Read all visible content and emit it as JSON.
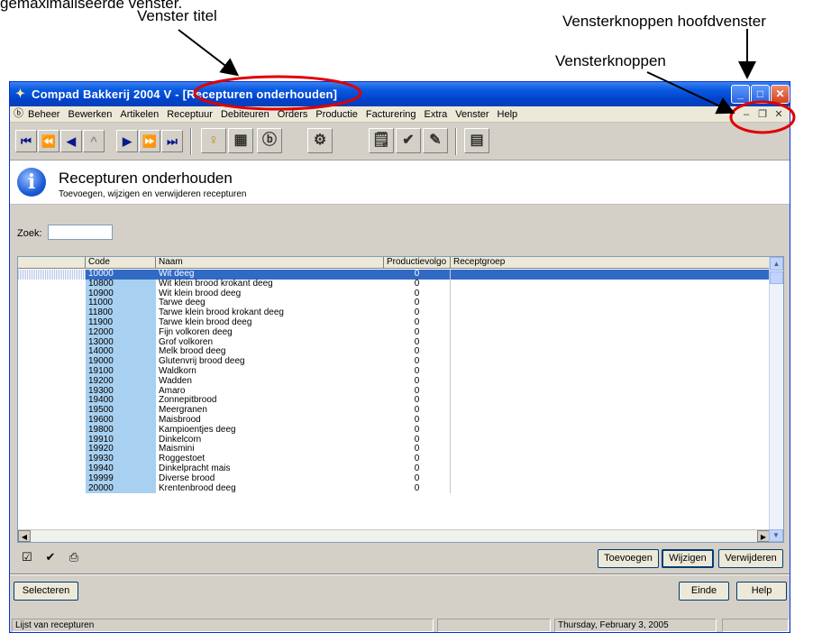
{
  "annotations": {
    "top_partial": "gemaximaliseerde venster.",
    "venster_titel": "Venster titel",
    "vensterknoppen_hoofdvenster": "Vensterknoppen hoofdvenster",
    "vensterknoppen": "Vensterknoppen"
  },
  "window": {
    "title": "Compad Bakkerij 2004 V - [Recepturen onderhouden]",
    "title_buttons": [
      "minimize",
      "maximize",
      "close"
    ]
  },
  "menubar": {
    "items": [
      "Beheer",
      "Bewerken",
      "Artikelen",
      "Receptuur",
      "Debiteuren",
      "Orders",
      "Productie",
      "Facturering",
      "Extra",
      "Venster",
      "Help"
    ]
  },
  "header": {
    "title": "Recepturen onderhouden",
    "subtitle": "Toevoegen, wijzigen en verwijderen recepturen"
  },
  "search": {
    "label": "Zoek:",
    "value": ""
  },
  "table": {
    "columns": [
      "",
      "Code",
      "Naam",
      "Productievolgo",
      "Receptgroep"
    ],
    "selected_index": 0,
    "rows": [
      {
        "code": "10000",
        "naam": "Wit deeg",
        "productie": "0",
        "groep": ""
      },
      {
        "code": "10800",
        "naam": "Wit klein brood krokant deeg",
        "productie": "0",
        "groep": ""
      },
      {
        "code": "10900",
        "naam": "Wit klein brood deeg",
        "productie": "0",
        "groep": ""
      },
      {
        "code": "11000",
        "naam": "Tarwe deeg",
        "productie": "0",
        "groep": ""
      },
      {
        "code": "11800",
        "naam": "Tarwe klein brood krokant deeg",
        "productie": "0",
        "groep": ""
      },
      {
        "code": "11900",
        "naam": "Tarwe klein brood deeg",
        "productie": "0",
        "groep": ""
      },
      {
        "code": "12000",
        "naam": "Fijn volkoren deeg",
        "productie": "0",
        "groep": ""
      },
      {
        "code": "13000",
        "naam": "Grof volkoren",
        "productie": "0",
        "groep": ""
      },
      {
        "code": "14000",
        "naam": "Melk brood deeg",
        "productie": "0",
        "groep": ""
      },
      {
        "code": "19000",
        "naam": "Glutenvrij brood deeg",
        "productie": "0",
        "groep": ""
      },
      {
        "code": "19100",
        "naam": "Waldkorn",
        "productie": "0",
        "groep": ""
      },
      {
        "code": "19200",
        "naam": "Wadden",
        "productie": "0",
        "groep": ""
      },
      {
        "code": "19300",
        "naam": "Amaro",
        "productie": "0",
        "groep": ""
      },
      {
        "code": "19400",
        "naam": "Zonnepitbrood",
        "productie": "0",
        "groep": ""
      },
      {
        "code": "19500",
        "naam": "Meergranen",
        "productie": "0",
        "groep": ""
      },
      {
        "code": "19600",
        "naam": "Maisbrood",
        "productie": "0",
        "groep": ""
      },
      {
        "code": "19800",
        "naam": "Kampioentjes deeg",
        "productie": "0",
        "groep": ""
      },
      {
        "code": "19910",
        "naam": "Dinkelcorn",
        "productie": "0",
        "groep": ""
      },
      {
        "code": "19920",
        "naam": "Maismini",
        "productie": "0",
        "groep": ""
      },
      {
        "code": "19930",
        "naam": "Roggestoet",
        "productie": "0",
        "groep": ""
      },
      {
        "code": "19940",
        "naam": "Dinkelpracht mais",
        "productie": "0",
        "groep": ""
      },
      {
        "code": "19999",
        "naam": "Diverse brood",
        "productie": "0",
        "groep": ""
      },
      {
        "code": "20000",
        "naam": "Krentenbrood deeg",
        "productie": "0",
        "groep": ""
      }
    ]
  },
  "buttons": {
    "toevoegen": "Toevoegen",
    "wijzigen": "Wijzigen",
    "verwijderen": "Verwijderen",
    "selecteren": "Selecteren",
    "einde": "Einde",
    "help": "Help"
  },
  "statusbar": {
    "left": "Lijst van recepturen",
    "date": "Thursday, February  3, 2005"
  },
  "colors": {
    "highlight": "#316ac5",
    "code_column": "#a8d0f0",
    "annotation_red": "#e00000"
  }
}
